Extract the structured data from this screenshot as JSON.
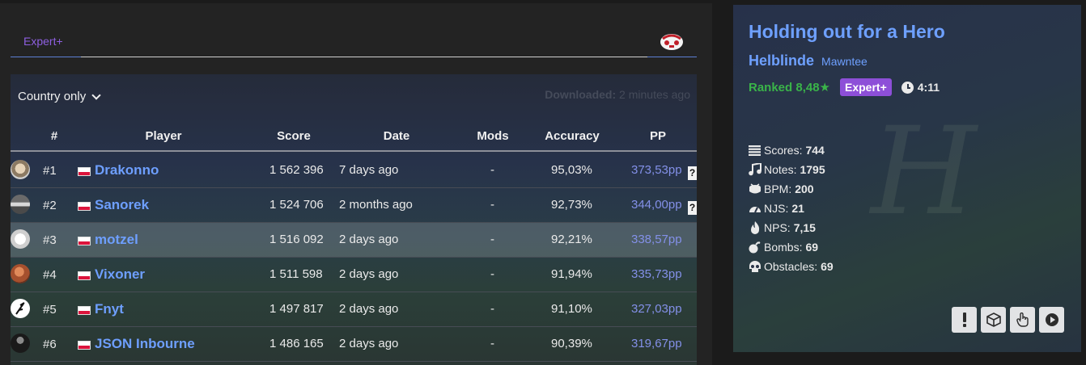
{
  "tabs": {
    "active": "Expert+"
  },
  "leaderboard": {
    "filter_label": "Country only",
    "downloaded_label": "Downloaded:",
    "downloaded_value": "2 minutes ago",
    "columns": [
      "#",
      "Player",
      "Score",
      "Date",
      "Mods",
      "Accuracy",
      "PP"
    ],
    "rows": [
      {
        "rank": "#1",
        "player": "Drakonno",
        "score": "1 562 396",
        "date": "7 days ago",
        "mods": "-",
        "accuracy": "95,03%",
        "pp": "373,53pp",
        "flag": "Poland",
        "help": "?"
      },
      {
        "rank": "#2",
        "player": "Sanorek",
        "score": "1 524 706",
        "date": "2 months ago",
        "mods": "-",
        "accuracy": "92,73%",
        "pp": "344,00pp",
        "flag": "Poland",
        "help": "?"
      },
      {
        "rank": "#3",
        "player": "motzel",
        "score": "1 516 092",
        "date": "2 days ago",
        "mods": "-",
        "accuracy": "92,21%",
        "pp": "338,57pp",
        "flag": "Poland"
      },
      {
        "rank": "#4",
        "player": "Vixoner",
        "score": "1 511 598",
        "date": "2 days ago",
        "mods": "-",
        "accuracy": "91,94%",
        "pp": "335,73pp",
        "flag": "Poland"
      },
      {
        "rank": "#5",
        "player": "Fnyt",
        "score": "1 497 817",
        "date": "2 days ago",
        "mods": "-",
        "accuracy": "91,10%",
        "pp": "327,03pp",
        "flag": "Poland"
      },
      {
        "rank": "#6",
        "player": "JSON Inbourne",
        "score": "1 486 165",
        "date": "2 days ago",
        "mods": "-",
        "accuracy": "90,39%",
        "pp": "319,67pp",
        "flag": "Poland"
      }
    ]
  },
  "song": {
    "title": "Holding out for a Hero",
    "author": "Helblinde",
    "mapper": "Mawntee",
    "ranked": "Ranked 8,48★",
    "difficulty": "Expert+",
    "duration": "4:11",
    "stats": [
      {
        "label": "Scores:",
        "value": "744",
        "icon": "list-icon"
      },
      {
        "label": "Notes:",
        "value": "1795",
        "icon": "music-note-icon"
      },
      {
        "label": "BPM:",
        "value": "200",
        "icon": "drum-icon"
      },
      {
        "label": "NJS:",
        "value": "21",
        "icon": "speedometer-icon"
      },
      {
        "label": "NPS:",
        "value": "7,15",
        "icon": "flame-icon"
      },
      {
        "label": "Bombs:",
        "value": "69",
        "icon": "bomb-icon"
      },
      {
        "label": "Obstacles:",
        "value": "69",
        "icon": "skull-icon"
      }
    ]
  },
  "actions": [
    {
      "name": "report-button",
      "icon": "exclamation-icon"
    },
    {
      "name": "download-button",
      "icon": "box-icon"
    },
    {
      "name": "oneclick-button",
      "icon": "pointer-icon"
    },
    {
      "name": "preview-button",
      "icon": "play-icon"
    }
  ],
  "colors": {
    "accent": "#6ea0ff",
    "difficulty": "#8d4fd8",
    "ranked": "#3ab449",
    "pp": "#8390e8"
  }
}
